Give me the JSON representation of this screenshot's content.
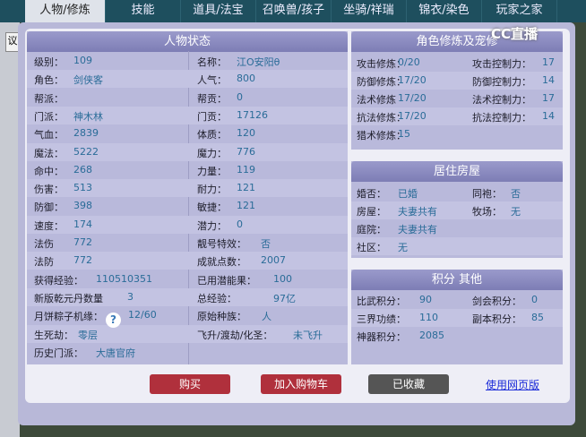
{
  "tabs": [
    "人物/修炼",
    "技能",
    "道具/法宝",
    "召唤兽/孩子",
    "坐骑/祥瑞",
    "锦衣/染色",
    "玩家之家"
  ],
  "left_box_text": "议",
  "logo": "CC直播",
  "status": {
    "title": "人物状态",
    "rows": [
      [
        [
          "级别：",
          "109"
        ],
        [
          "名称：",
          "江O安阳θ"
        ]
      ],
      [
        [
          "角色：",
          "剑侠客"
        ],
        [
          "人气：",
          "800"
        ]
      ],
      [
        [
          "帮派：",
          ""
        ],
        [
          "帮贡：",
          "0"
        ]
      ],
      [
        [
          "门派：",
          "神木林"
        ],
        [
          "门贡：",
          "17126"
        ]
      ],
      [
        [
          "气血：",
          "2839"
        ],
        [
          "体质：",
          "120"
        ]
      ],
      [
        [
          "魔法：",
          "5222"
        ],
        [
          "魔力：",
          "776"
        ]
      ],
      [
        [
          "命中：",
          "268"
        ],
        [
          "力量：",
          "119"
        ]
      ],
      [
        [
          "伤害：",
          "513"
        ],
        [
          "耐力：",
          "121"
        ]
      ],
      [
        [
          "防御：",
          "398"
        ],
        [
          "敏捷：",
          "121"
        ]
      ],
      [
        [
          "速度：",
          "174"
        ],
        [
          "潜力：",
          "0"
        ]
      ],
      [
        [
          "法伤",
          "772"
        ],
        [
          "靓号特效：",
          "否"
        ]
      ],
      [
        [
          "法防",
          "772"
        ],
        [
          "成就点数：",
          "2007"
        ]
      ],
      [
        [
          "获得经验：",
          "110510351"
        ],
        [
          "已用潜能果：",
          "100"
        ]
      ],
      [
        [
          "新版乾元丹数量",
          "3"
        ],
        [
          "总经验：",
          "97亿"
        ]
      ],
      [
        [
          "月饼粽子机缘：",
          "12/60"
        ],
        [
          "原始种族：",
          "人"
        ]
      ],
      [
        [
          "生死劫：",
          "零层"
        ],
        [
          "飞升/渡劫/化圣：",
          "未飞升"
        ]
      ],
      [
        [
          "历史门派：",
          "大唐官府"
        ]
      ]
    ],
    "help_icon": "?"
  },
  "cultivation": {
    "title": "角色修炼及宠修",
    "rows": [
      [
        [
          "攻击修炼：",
          "0/20"
        ],
        [
          "攻击控制力：",
          "17"
        ]
      ],
      [
        [
          "防御修炼：",
          "17/20"
        ],
        [
          "防御控制力：",
          "14"
        ]
      ],
      [
        [
          "法术修炼",
          "17/20"
        ],
        [
          "法术控制力：",
          "17"
        ]
      ],
      [
        [
          "抗法修炼：",
          "17/20"
        ],
        [
          "抗法控制力：",
          "14"
        ]
      ],
      [
        [
          "猎术修炼：",
          "15"
        ]
      ]
    ]
  },
  "house": {
    "title": "居住房屋",
    "rows": [
      [
        [
          "婚否：",
          "已婚"
        ],
        [
          "同袍：",
          "否"
        ]
      ],
      [
        [
          "房屋：",
          "夫妻共有"
        ],
        [
          "牧场：",
          "无"
        ]
      ],
      [
        [
          "庭院：",
          "夫妻共有"
        ]
      ],
      [
        [
          "社区：",
          "无"
        ]
      ]
    ]
  },
  "scores": {
    "title": "积分 其他",
    "rows": [
      [
        [
          "比武积分：",
          "90"
        ],
        [
          "剑会积分：",
          "0"
        ]
      ],
      [
        [
          "三界功绩：",
          "110"
        ],
        [
          "副本积分：",
          "85"
        ]
      ],
      [
        [
          "神器积分：",
          "2085"
        ]
      ]
    ]
  },
  "buttons": {
    "buy": "购买",
    "add_cart": "加入购物车",
    "favorited": "已收藏",
    "web_version": "使用网页版"
  },
  "colors": {
    "buy": "#b0303c",
    "favorited": "#555555",
    "link": "#1b2bd8"
  }
}
